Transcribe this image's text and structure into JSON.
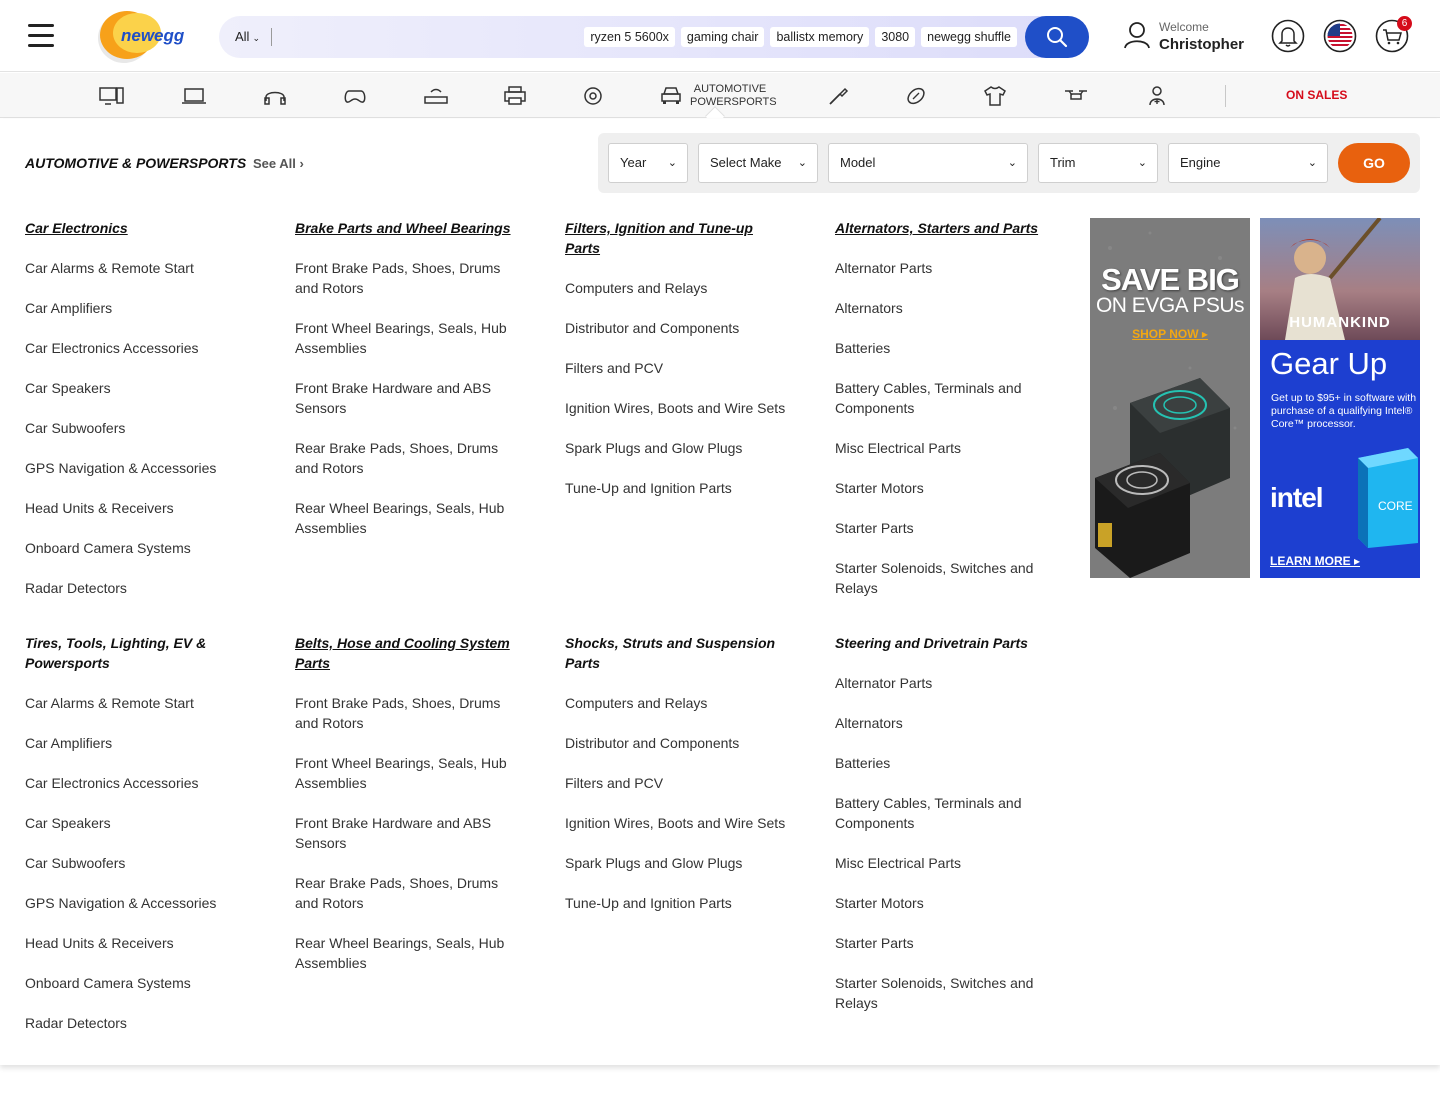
{
  "header": {
    "logo_text": "newegg",
    "search": {
      "category": "All",
      "placeholder": "",
      "chips": [
        "ryzen 5 5600x",
        "gaming chair",
        "ballistx memory",
        "3080",
        "newegg shuffle"
      ]
    },
    "user": {
      "welcome": "Welcome",
      "name": "Christopher"
    },
    "cart_count": "6"
  },
  "category_bar": {
    "icons": [
      "desktop-icon",
      "laptop-icon",
      "headphones-icon",
      "gamepad-icon",
      "router-icon",
      "printer-icon",
      "disc-icon",
      "car-icon",
      "tools-icon",
      "football-icon",
      "tshirt-icon",
      "drone-icon",
      "medical-icon"
    ],
    "active_label": "AUTOMOTIVE POWERSPORTS",
    "on_sales": "ON SALES"
  },
  "mega_menu": {
    "title": "AUTOMOTIVE & POWERSPORTS",
    "see_all": "See All",
    "vehicle_selector": {
      "year": "Year",
      "make": "Select Make",
      "model": "Model",
      "trim": "Trim",
      "engine": "Engine",
      "go": "GO"
    },
    "columns": [
      {
        "heading": "Car Electronics",
        "items": [
          "Car Alarms & Remote Start",
          "Car Amplifiers",
          "Car Electronics Accessories",
          "Car Speakers",
          "Car Subwoofers",
          "GPS Navigation & Accessories",
          "Head Units & Receivers",
          "Onboard Camera Systems",
          "Radar Detectors"
        ]
      },
      {
        "heading": "Brake Parts and Wheel Bearings",
        "items": [
          "Front Brake Pads, Shoes, Drums and Rotors",
          "Front Wheel Bearings, Seals, Hub Assemblies",
          "Front Brake Hardware and ABS Sensors",
          "Rear Brake Pads, Shoes, Drums and Rotors",
          "Rear Wheel Bearings, Seals, Hub Assemblies"
        ]
      },
      {
        "heading": "Filters, Ignition and Tune-up Parts",
        "items": [
          "Computers and Relays",
          "Distributor and Components",
          "Filters and PCV",
          "Ignition Wires, Boots and Wire Sets",
          "Spark Plugs and Glow Plugs",
          "Tune-Up and Ignition Parts"
        ]
      },
      {
        "heading": "Alternators, Starters and Parts",
        "items": [
          "Alternator Parts",
          "Alternators",
          "Batteries",
          "Battery Cables, Terminals and Components",
          "Misc Electrical Parts",
          "Starter Motors",
          "Starter Parts",
          "Starter Solenoids, Switches and Relays"
        ]
      },
      {
        "heading": "Tires, Tools, Lighting, EV & Powersports",
        "items": [
          "Car Alarms & Remote Start",
          "Car Amplifiers",
          "Car Electronics Accessories",
          "Car Speakers",
          "Car Subwoofers",
          "GPS Navigation & Accessories",
          "Head Units & Receivers",
          "Onboard Camera Systems",
          "Radar Detectors"
        ]
      },
      {
        "heading": "Belts, Hose and Cooling System Parts",
        "items": [
          "Front Brake Pads, Shoes, Drums and Rotors",
          "Front Wheel Bearings, Seals, Hub Assemblies",
          "Front Brake Hardware and ABS Sensors",
          "Rear Brake Pads, Shoes, Drums and Rotors",
          "Rear Wheel Bearings, Seals, Hub Assemblies"
        ]
      },
      {
        "heading": "Shocks, Struts and Suspension Parts",
        "items": [
          "Computers and Relays",
          "Distributor and Components",
          "Filters and PCV",
          "Ignition Wires, Boots and Wire Sets",
          "Spark Plugs and Glow Plugs",
          "Tune-Up and Ignition Parts"
        ]
      },
      {
        "heading": "Steering and Drivetrain Parts",
        "items": [
          "Alternator Parts",
          "Alternators",
          "Batteries",
          "Battery Cables, Terminals and Components",
          "Misc Electrical Parts",
          "Starter Motors",
          "Starter Parts",
          "Starter Solenoids, Switches and Relays"
        ]
      }
    ]
  },
  "ads": {
    "evga": {
      "line1": "SAVE BIG",
      "line2": "ON EVGA PSUs",
      "cta": "SHOP NOW ▸"
    },
    "intel": {
      "game": "HUMANKIND",
      "headline": "Gear Up",
      "desc": "Get up to $95+ in software with purchase of a qualifying Intel® Core™ processor.",
      "brand": "intel",
      "cta": "LEARN MORE ▸"
    }
  },
  "colors": {
    "brand_blue": "#1f4fc8",
    "go_orange": "#e8610e",
    "sale_red": "#d50b1a",
    "intel_blue": "#1d3fd0"
  }
}
